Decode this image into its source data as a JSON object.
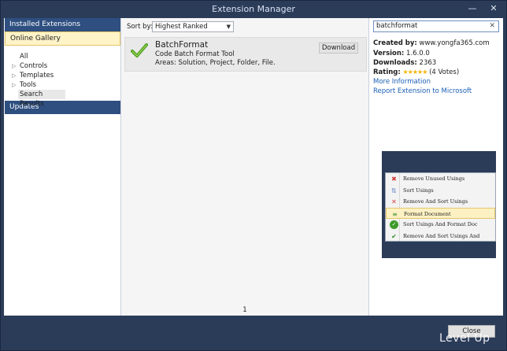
{
  "window": {
    "title": "Extension Manager",
    "controls": {
      "minimize": "—",
      "close": "✕"
    }
  },
  "nav": {
    "installed": "Installed Extensions",
    "online": "Online Gallery",
    "items": [
      {
        "label": "All",
        "expandable": false
      },
      {
        "label": "Controls",
        "expandable": true
      },
      {
        "label": "Templates",
        "expandable": true
      },
      {
        "label": "Tools",
        "expandable": true
      },
      {
        "label": "Search Results",
        "expandable": false
      }
    ],
    "updates": "Updates"
  },
  "toolbar": {
    "sort_label": "Sort by:",
    "sort_value": "Highest Ranked"
  },
  "result": {
    "title": "BatchFormat",
    "description": "Code Batch Format Tool",
    "areas": "Areas: Solution, Project, Folder, File.",
    "download_label": "Download"
  },
  "pager": {
    "page": "1"
  },
  "search": {
    "value": "batchformat",
    "clear_icon": "close-icon"
  },
  "details": {
    "created_by_label": "Created by:",
    "created_by_value": "www.yongfa365.com",
    "version_label": "Version:",
    "version_value": "1.6.0.0",
    "downloads_label": "Downloads:",
    "downloads_value": "2363",
    "rating_label": "Rating:",
    "rating_stars": "★★★★★",
    "rating_votes": "(4 Votes)",
    "more_info": "More Information",
    "report": "Report Extension to Microsoft"
  },
  "preview_menu": {
    "items": [
      {
        "label": "Remove Unused Usings",
        "icon": "remove-unused-icon"
      },
      {
        "label": "Sort Usings",
        "icon": "sort-icon"
      },
      {
        "label": "Remove And Sort Usings",
        "icon": "remove-sort-icon"
      },
      {
        "label": "Format Document",
        "icon": "format-icon",
        "highlighted": true
      },
      {
        "label": "Sort Usings And Format Doc",
        "icon": "green-check-icon"
      },
      {
        "label": "Remove And Sort Usings And",
        "icon": "check-icon"
      }
    ]
  },
  "footer": {
    "close_label": "Close",
    "watermark": "Level Up"
  },
  "colors": {
    "chrome": "#2b3c59",
    "nav_header": "#2e4f80",
    "selection": "#fff3c8",
    "link": "#1c5fb5",
    "star": "#f4b400"
  }
}
